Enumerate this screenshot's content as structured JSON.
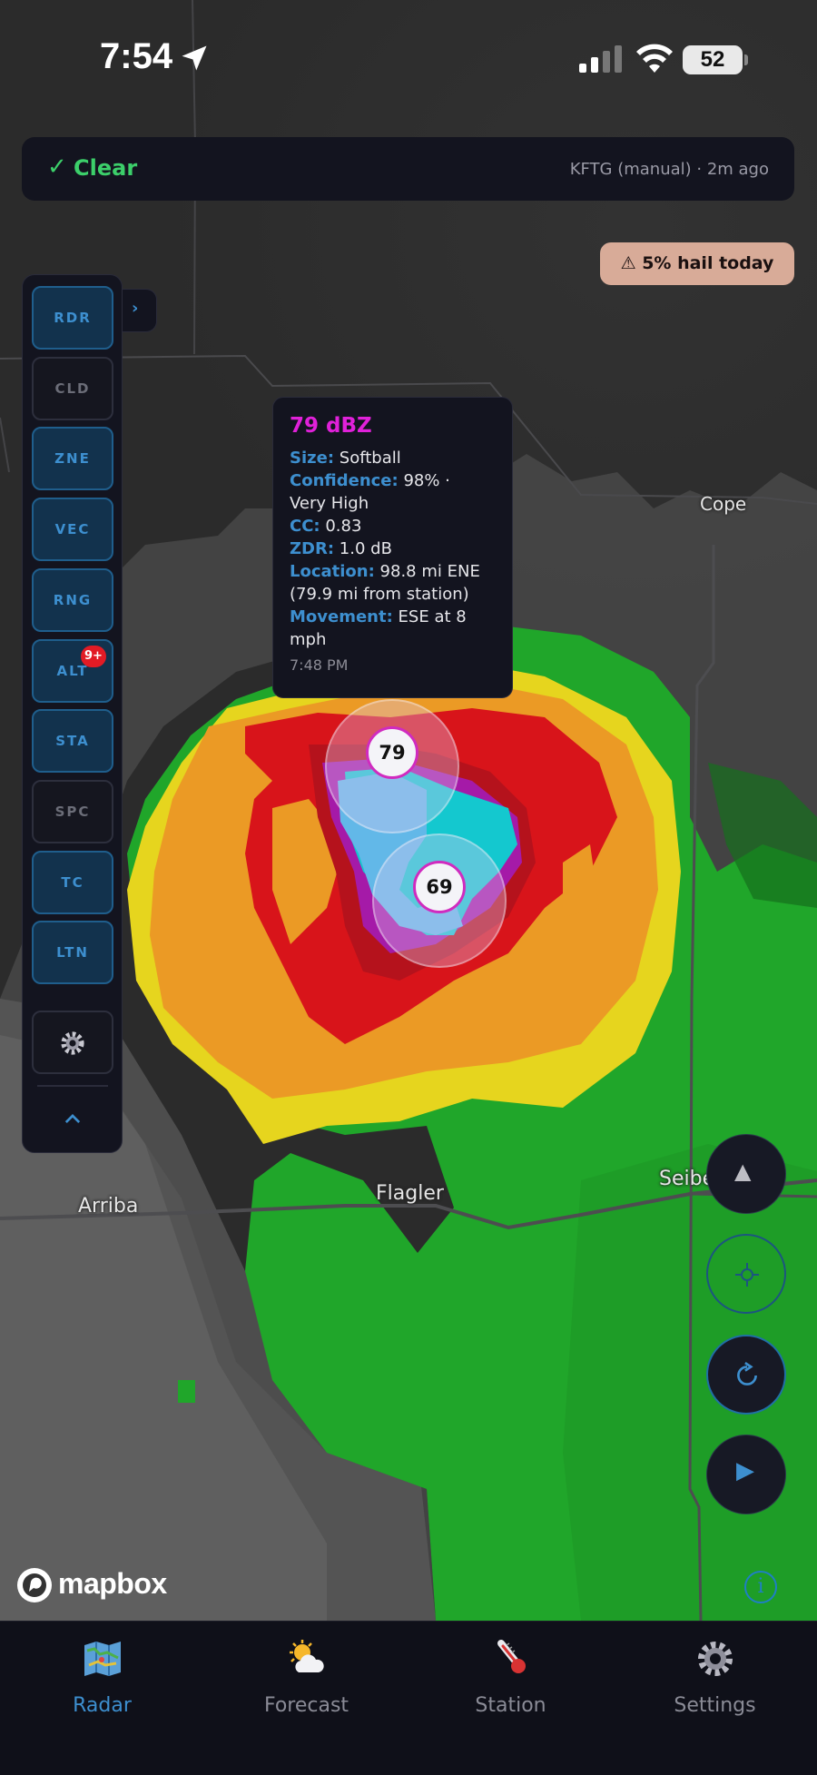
{
  "status_bar": {
    "time": "7:54",
    "battery": "52"
  },
  "top_bar": {
    "status": "Clear",
    "station_info": "KFTG (manual) · 2m ago"
  },
  "hail_banner": {
    "text": "⚠ 5% hail today"
  },
  "toolbar": {
    "buttons": [
      {
        "label": "RDR",
        "active": true
      },
      {
        "label": "CLD",
        "active": false
      },
      {
        "label": "ZNE",
        "active": true
      },
      {
        "label": "VEC",
        "active": true
      },
      {
        "label": "RNG",
        "active": true
      },
      {
        "label": "ALT",
        "active": true,
        "badge": "9+"
      },
      {
        "label": "STA",
        "active": true
      },
      {
        "label": "SPC",
        "active": false
      },
      {
        "label": "TC",
        "active": true
      },
      {
        "label": "LTN",
        "active": true
      }
    ],
    "expand_glyph": "›",
    "collapse_glyph": "^"
  },
  "popup": {
    "dbz": "79 dBZ",
    "size_label": "Size:",
    "size_value": "Softball",
    "confidence_label": "Confidence:",
    "confidence_value": "98% ·",
    "confidence_value_2": "Very High",
    "cc_label": "CC:",
    "cc_value": "0.83",
    "zdr_label": "ZDR:",
    "zdr_value": "1.0 dB",
    "location_label": "Location:",
    "location_value": "98.8 mi ENE",
    "location_value_2": "(79.9 mi from station)",
    "movement_label": "Movement:",
    "movement_value": "ESE at 8",
    "movement_value_2": "mph",
    "timestamp": "7:48 PM"
  },
  "markers": {
    "upper": "79",
    "lower": "69"
  },
  "towns": {
    "cope": "Cope",
    "arriba": "Arriba",
    "flagler": "Flagler",
    "seibert": "Seibert"
  },
  "map_controls": {
    "north_glyph": "▲",
    "play_glyph": "▶",
    "info_glyph": "i"
  },
  "attribution": {
    "brand": "mapbox"
  },
  "bottom_nav": {
    "items": [
      {
        "label": "Radar",
        "icon": "map-icon",
        "active": true
      },
      {
        "label": "Forecast",
        "icon": "sun-cloud-icon",
        "active": false
      },
      {
        "label": "Station",
        "icon": "thermometer-icon",
        "active": false
      },
      {
        "label": "Settings",
        "icon": "gear-icon",
        "active": false
      }
    ]
  },
  "colors": {
    "accent": "#3d8fcf",
    "clear_green": "#3ccf6a",
    "dbz_magenta": "#e021d9",
    "badge_red": "#e21b25",
    "hail_banner": "#d8ab98",
    "panel_bg": "#13141f"
  }
}
